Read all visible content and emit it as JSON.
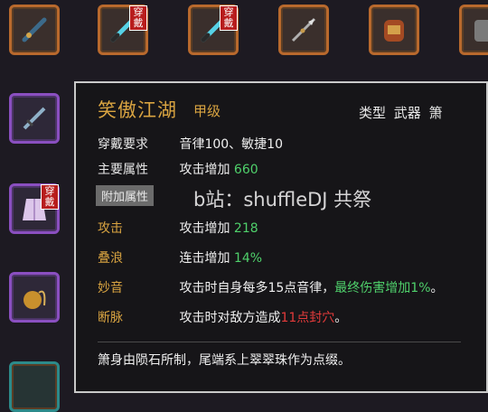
{
  "inventory": {
    "wear_label": "穿戴"
  },
  "tooltip": {
    "title": "笑傲江湖",
    "grade": "甲级",
    "type_label": "类型",
    "type_value": "武器 箫",
    "requirement_label": "穿戴要求",
    "requirement_value": "音律100、敏捷10",
    "main_attr_label": "主要属性",
    "main_attr_text": "攻击增加",
    "main_attr_value": "660",
    "extra_attr_label": "附加属性",
    "attack_label": "攻击",
    "attack_text": "攻击增加",
    "attack_value": "218",
    "dieLang_label": "叠浪",
    "dieLang_text": "连击增加",
    "dieLang_value": "14%",
    "miaoyin_label": "妙音",
    "miaoyin_text": "攻击时自身每多15点音律，",
    "miaoyin_highlight": "最终伤害增加1%",
    "miaoyin_end": "。",
    "duanmai_label": "断脉",
    "duanmai_text": "攻击时对敌方造成",
    "duanmai_highlight": "11点封穴",
    "duanmai_end": "。",
    "description": "箫身由陨石所制，尾端系上翠翠珠作为点缀。",
    "watermark": "b站：shuffleDJ 共祭"
  },
  "colors": {
    "title": "#d9a441",
    "value_green": "#4fd06b",
    "value_red": "#e23a3a",
    "badge": "#b81d1d"
  }
}
